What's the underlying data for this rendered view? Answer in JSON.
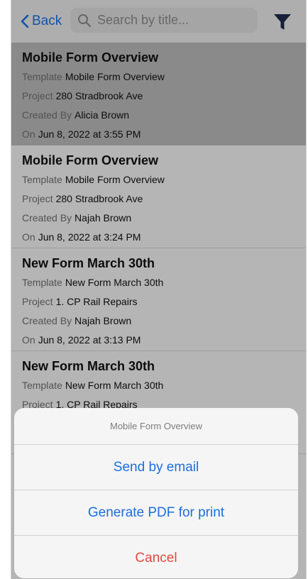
{
  "nav": {
    "back_label": "Back",
    "search_placeholder": "Search by title...",
    "back_icon": "chevron-left",
    "search_icon": "magnifier",
    "filter_icon": "funnel"
  },
  "colors": {
    "accent": "#1a6fe0",
    "destructive": "#e5483d",
    "selected_row": "#b8b8b8"
  },
  "forms": [
    {
      "title": "Mobile Form Overview",
      "template_label": "Template",
      "template": "Mobile Form Overview",
      "project_label": "Project",
      "project": "280 Stradbrook Ave",
      "created_label": "Created By",
      "created_by": "Alicia Brown",
      "on_label": "On",
      "on": "Jun 8, 2022 at 3:55 PM",
      "selected": true
    },
    {
      "title": "Mobile Form Overview",
      "template_label": "Template",
      "template": "Mobile Form Overview",
      "project_label": "Project",
      "project": "280 Stradbrook Ave",
      "created_label": "Created By",
      "created_by": "Najah Brown",
      "on_label": "On",
      "on": "Jun 8, 2022 at 3:24 PM",
      "selected": false
    },
    {
      "title": "New Form March 30th",
      "template_label": "Template",
      "template": "New Form March 30th",
      "project_label": "Project",
      "project": "1. CP Rail Repairs",
      "created_label": "Created By",
      "created_by": "Najah Brown",
      "on_label": "On",
      "on": "Jun 8, 2022 at 3:13 PM",
      "selected": false
    },
    {
      "title": "New Form March 30th",
      "template_label": "Template",
      "template": "New Form March 30th",
      "project_label": "Project",
      "project": "1. CP Rail Repairs",
      "created_label": "",
      "created_by": "",
      "on_label": "",
      "on": "",
      "selected": false
    }
  ],
  "action_sheet": {
    "title": "Mobile Form Overview",
    "send_email": "Send by email",
    "generate_pdf": "Generate PDF for print",
    "cancel": "Cancel"
  }
}
